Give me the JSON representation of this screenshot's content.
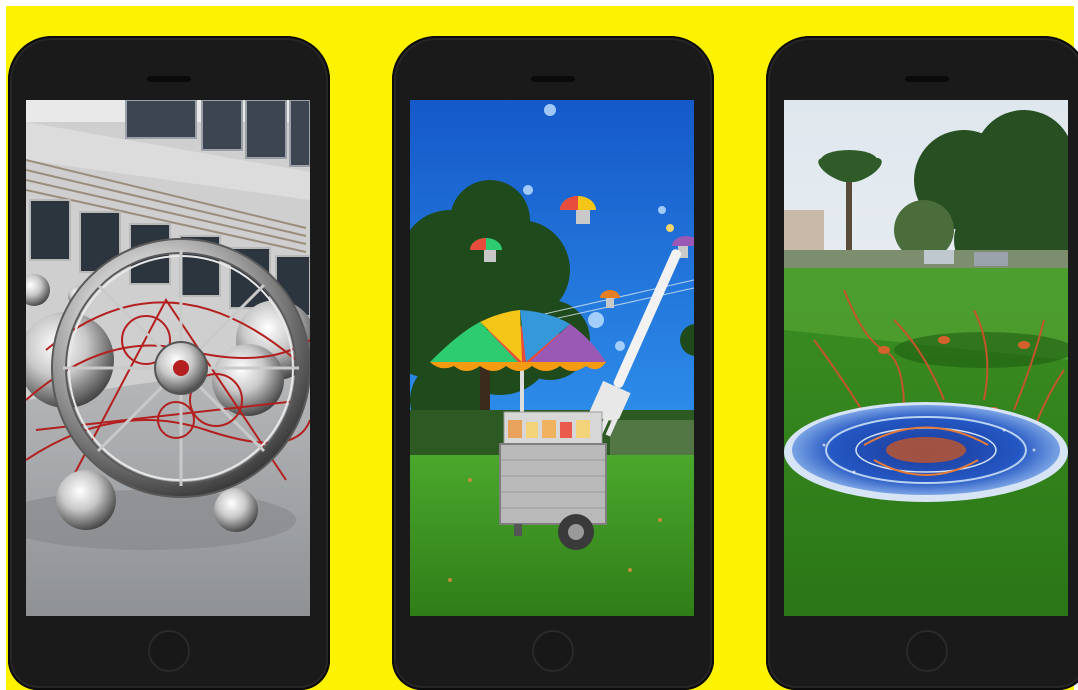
{
  "colors": {
    "background": "#fdf300",
    "phone_body": "#1a1a1a",
    "sky": "#1e6fd8",
    "grass": "#3f9a23"
  },
  "phones": [
    {
      "scene": "metal-wheel-sculpture"
    },
    {
      "scene": "food-cart-with-umbrella-and-fork"
    },
    {
      "scene": "painted-ground-portal"
    }
  ]
}
